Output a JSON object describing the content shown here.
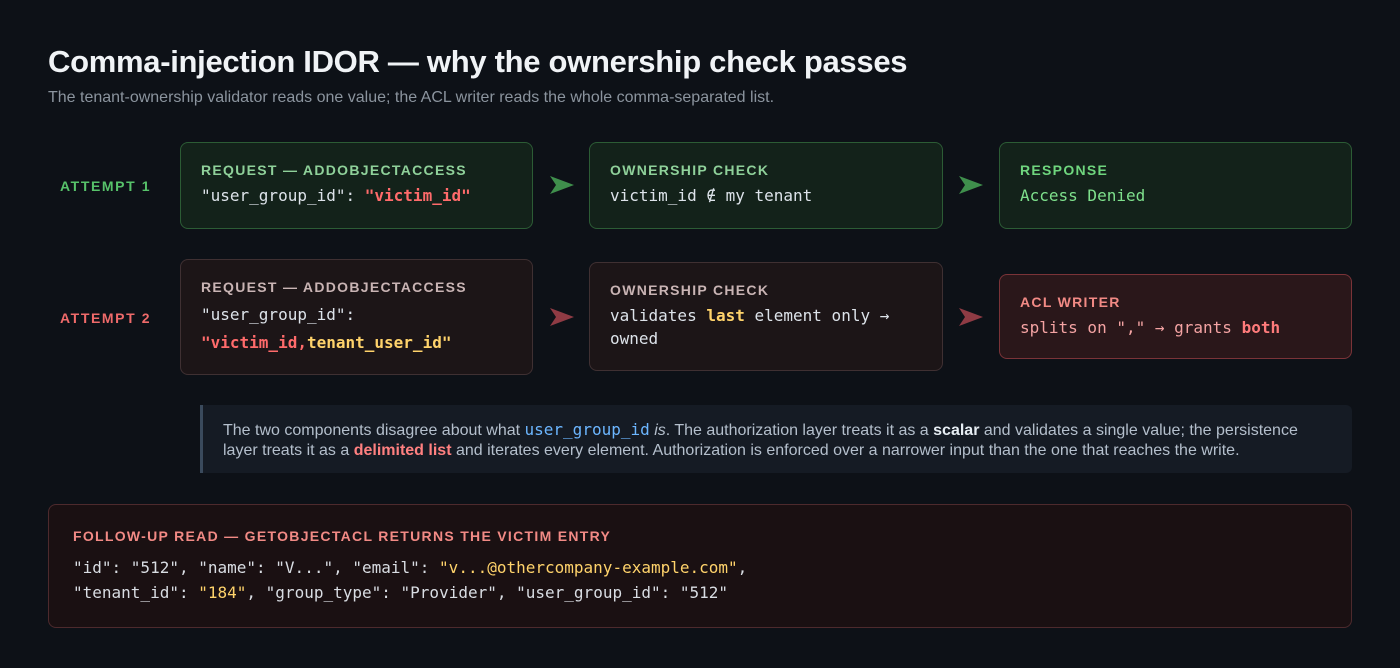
{
  "header": {
    "title": "Comma-injection IDOR — why the ownership check passes",
    "subtitle": "The tenant-ownership validator reads one value; the ACL writer reads the whole comma-separated list."
  },
  "attempt1": {
    "label": "ATTEMPT 1",
    "request": {
      "title": "REQUEST — ADDOBJECTACCESS",
      "key": "\"user_group_id\": ",
      "value": "\"victim_id\""
    },
    "check": {
      "title": "OWNERSHIP CHECK",
      "text": "victim_id ∉ my tenant"
    },
    "response": {
      "title": "RESPONSE",
      "text": "Access Denied"
    }
  },
  "attempt2": {
    "label": "ATTEMPT 2",
    "request": {
      "title": "REQUEST — ADDOBJECTACCESS",
      "key": "\"user_group_id\":",
      "value_victim": "\"victim_id,",
      "value_tenant": "tenant_user_id\""
    },
    "check": {
      "title": "OWNERSHIP CHECK",
      "pre": "validates ",
      "highlight": "last",
      "post": " element only →",
      "line2": "owned"
    },
    "writer": {
      "title": "ACL WRITER",
      "pre": "splits on \",\" → grants ",
      "highlight": "both"
    }
  },
  "note": {
    "p1": "The two components disagree about what ",
    "code": "user_group_id",
    "p2": " is",
    "p3": ". The authorization layer treats it as a ",
    "scalar": "scalar",
    "p4": " and validates a single value; the persistence layer treats it as a ",
    "list": "delimited list",
    "p5": " and iterates every element. Authorization is enforced over a narrower input than the one that reaches the write."
  },
  "followup": {
    "title": "FOLLOW-UP READ — GETOBJECTACL RETURNS THE VICTIM ENTRY",
    "line1_pre": "\"id\": \"512\", \"name\": \"V...\", \"email\": ",
    "line1_email": "\"v...@othercompany-example.com\"",
    "line1_post": ",",
    "line2_pre": "\"tenant_id\": ",
    "line2_tenant": "\"184\"",
    "line2_post": ", \"group_type\": \"Provider\", \"user_group_id\": \"512\""
  },
  "colors": {
    "attempt1_accent": "#57c26a",
    "attempt2_accent": "#ef6a6a",
    "highlight_yellow": "#ffd36b",
    "highlight_red": "#ff6b6b",
    "inline_code_blue": "#6cb6ff"
  },
  "icons": {
    "flow_arrow_1": "arrow-right-icon",
    "flow_arrow_2": "arrow-right-icon"
  }
}
